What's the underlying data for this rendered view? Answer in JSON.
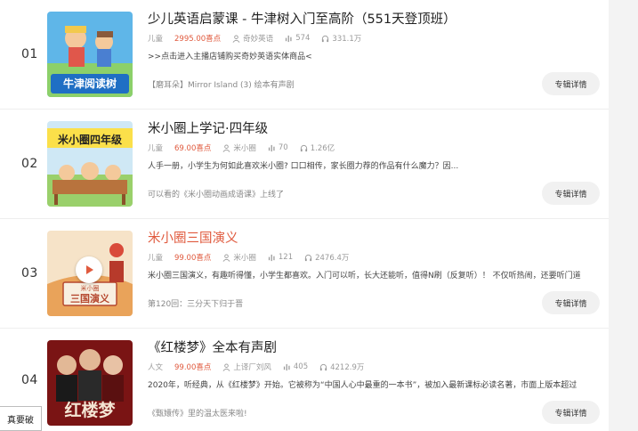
{
  "albums": [
    {
      "rank": "01",
      "title": "少儿英语启蒙课 - 牛津树入门至高阶（551天登顶班）",
      "category": "儿童",
      "price": "2995.00喜点",
      "author": "奇妙英语",
      "tracks": "574",
      "plays": "331.1万",
      "desc": ">>点击进入主播店铺购买奇妙英语实体商品<",
      "latest": "【磨耳朵】Mirror Island (3) 绘本有声剧",
      "button": "专辑详情",
      "cover_text": "牛津阅读树",
      "title_color": "#222222"
    },
    {
      "rank": "02",
      "title": "米小圈上学记·四年级",
      "category": "儿童",
      "price": "69.00喜点",
      "author": "米小圈",
      "tracks": "70",
      "plays": "1.26亿",
      "desc": "人手一册，小学生为何如此喜欢米小圈? 口口相传，家长圈力荐的作品有什么魔力？因...",
      "latest": "可以看的《米小圈动画成语课》上线了",
      "button": "专辑详情",
      "cover_text": "米小圈四年级",
      "title_color": "#222222"
    },
    {
      "rank": "03",
      "title": "米小圈三国演义",
      "category": "儿童",
      "price": "99.00喜点",
      "author": "米小圈",
      "tracks": "121",
      "plays": "2476.4万",
      "desc": "米小圈三国演义，有趣听得懂，小学生都喜欢。入门可以听，长大还能听，值得N刷（反复听）！ 不仅听热闹，还要听门道",
      "latest": "第120回：三分天下归于晋",
      "button": "专辑详情",
      "cover_text": "三国演义",
      "cover_small": "米小圈",
      "title_color": "#e05a3e"
    },
    {
      "rank": "04",
      "title": "《红楼梦》全本有声剧",
      "category": "人文",
      "price": "99.00喜点",
      "author": "上译厂刘风",
      "tracks": "405",
      "plays": "4212.9万",
      "desc": "2020年，听经典，从《红楼梦》开始。它被称为“中国人心中最重的一本书”，被加入最新课标必读名著，市面上版本超过",
      "latest": "《甄嬛传》里的温太医来啦!",
      "button": "专辑详情",
      "cover_text": "红楼梦",
      "title_color": "#222222"
    }
  ],
  "corner_text": "真要破",
  "colors": {
    "accent": "#e05a3e",
    "meta": "#999999",
    "button_bg": "#f1f1f1"
  },
  "icons": [
    "user-icon",
    "tracks-icon",
    "headphones-icon",
    "play-icon"
  ]
}
